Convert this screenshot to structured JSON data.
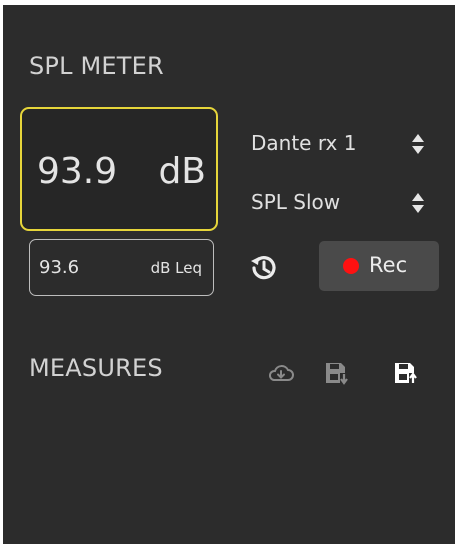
{
  "spl_meter": {
    "title": "SPL METER",
    "level": {
      "value": "93.9",
      "unit": "dB"
    },
    "leq": {
      "value": "93.6",
      "unit": "dB Leq"
    },
    "source_select": {
      "selected": "Dante rx 1",
      "icon": "updown-arrows-icon"
    },
    "mode_select": {
      "selected": "SPL Slow",
      "icon": "updown-arrows-icon"
    },
    "history_icon": "history-icon",
    "rec_button": {
      "label": "Rec",
      "dot_color": "#ff1111"
    },
    "main_border_color": "#e6d53a"
  },
  "measures": {
    "title": "MEASURES",
    "icons": [
      "cloud-download-icon",
      "save-download-icon",
      "save-upload-icon"
    ]
  }
}
